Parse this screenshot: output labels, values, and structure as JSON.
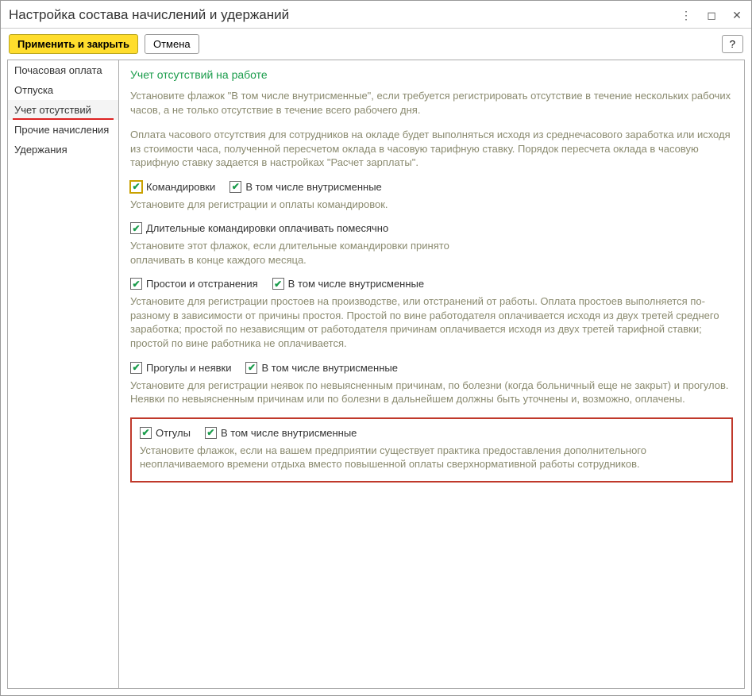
{
  "title": "Настройка состава начислений и удержаний",
  "toolbar": {
    "apply": "Применить и закрыть",
    "cancel": "Отмена",
    "help": "?"
  },
  "sidebar": {
    "items": [
      {
        "label": "Почасовая оплата"
      },
      {
        "label": "Отпуска"
      },
      {
        "label": "Учет отсутствий"
      },
      {
        "label": "Прочие начисления"
      },
      {
        "label": "Удержания"
      }
    ]
  },
  "content": {
    "heading": "Учет отсутствий на работе",
    "intro1": "Установите флажок \"В том числе внутрисменные\", если требуется регистрировать отсутствие в течение нескольких рабочих часов, а не только отсутствие в течение всего рабочего дня.",
    "intro2": "Оплата часового отсутствия для сотрудников на окладе будет выполняться исходя из среднечасового заработка или исходя из стоимости часа, полученной пересчетом оклада в часовую тарифную ставку. Порядок пересчета оклада в часовую тарифную ставку задается в настройках \"Расчет зарплаты\".",
    "s1": {
      "cb1": "Командировки",
      "cb2": "В том числе внутрисменные",
      "help": "Установите для регистрации и оплаты командировок."
    },
    "s2": {
      "cb1": "Длительные командировки оплачивать помесячно",
      "help": "Установите этот флажок, если длительные командировки принято оплачивать в конце каждого месяца."
    },
    "s3": {
      "cb1": "Простои и отстранения",
      "cb2": "В том числе внутрисменные",
      "help": "Установите для регистрации простоев на производстве, или отстранений от работы. Оплата простоев выполняется по-разному в зависимости от причины простоя. Простой по вине работодателя оплачивается исходя из двух третей среднего заработка; простой по независящим от работодателя причинам оплачивается исходя из двух третей тарифной ставки; простой по вине работника не оплачивается."
    },
    "s4": {
      "cb1": "Прогулы и неявки",
      "cb2": "В том числе внутрисменные",
      "help": "Установите для регистрации неявок по невыясненным причинам, по болезни (когда больничный еще не закрыт) и прогулов. Неявки по невыясненным причинам или по болезни в дальнейшем должны быть уточнены и, возможно, оплачены."
    },
    "s5": {
      "cb1": "Отгулы",
      "cb2": "В том числе внутрисменные",
      "help": "Установите флажок, если на вашем предприятии существует практика предоставления дополнительного неоплачиваемого времени отдыха вместо повышенной оплаты сверхнормативной работы сотрудников."
    }
  }
}
